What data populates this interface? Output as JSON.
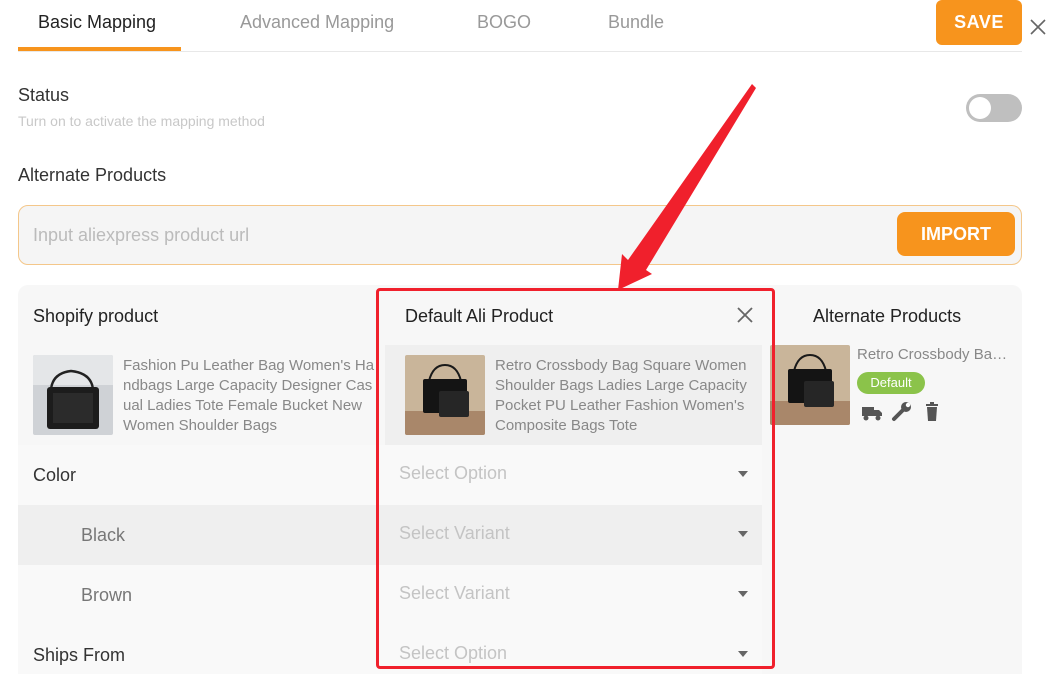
{
  "tabs": [
    {
      "label": "Basic Mapping"
    },
    {
      "label": "Advanced Mapping"
    },
    {
      "label": "BOGO"
    },
    {
      "label": "Bundle"
    }
  ],
  "header": {
    "save_label": "SAVE"
  },
  "status": {
    "title": "Status",
    "subtitle": "Turn on to activate the mapping method",
    "enabled": false
  },
  "alternate": {
    "title": "Alternate Products",
    "url_placeholder": "Input aliexpress product url",
    "import_label": "IMPORT"
  },
  "columns": {
    "shopify": "Shopify product",
    "default_ali": "Default Ali Product",
    "alternate": "Alternate Products"
  },
  "shopify_product": {
    "title": "Fashion Pu Leather Bag Women's Handbags Large Capacity Designer Casual Ladies Tote Female Bucket New Women Shoulder Bags"
  },
  "ali_product": {
    "title": "Retro Crossbody Bag Square Women Shoulder Bags Ladies Large Capacity Pocket PU Leather Fashion Women's Composite Bags Tote"
  },
  "alt_product": {
    "title": "Retro Crossbody Bag Square Women Shoulder Bags",
    "badge": "Default"
  },
  "rows": [
    {
      "label": "Color",
      "select": "Select Option"
    },
    {
      "label": "Black",
      "select": "Select Variant"
    },
    {
      "label": "Brown",
      "select": "Select Variant"
    },
    {
      "label": "Ships From",
      "select": "Select Option"
    }
  ],
  "colors": {
    "accent": "#f7941d",
    "highlight": "#f0202c",
    "badge": "#8bc34a"
  }
}
